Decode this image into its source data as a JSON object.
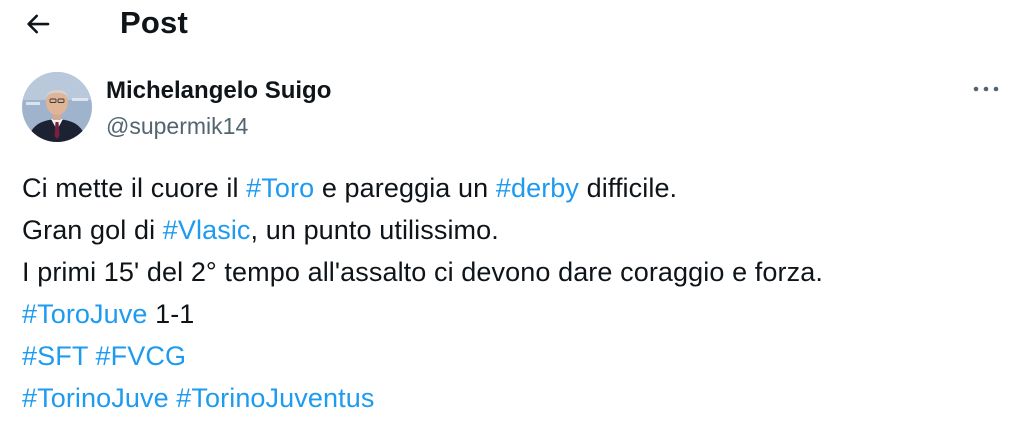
{
  "header": {
    "back_icon": "arrow-left-icon",
    "title": "Post"
  },
  "author": {
    "name": "Michelangelo Suigo",
    "handle": "@supermik14",
    "more_icon": "more-horizontal-icon"
  },
  "post": {
    "lines": [
      [
        {
          "t": "Ci mette il cuore il "
        },
        {
          "t": "#Toro",
          "tag": true
        },
        {
          "t": " e pareggia un "
        },
        {
          "t": "#derby",
          "tag": true
        },
        {
          "t": " difficile."
        }
      ],
      [
        {
          "t": "Gran gol di "
        },
        {
          "t": "#Vlasic",
          "tag": true
        },
        {
          "t": ", un punto utilissimo."
        }
      ],
      [
        {
          "t": "I primi 15' del 2° tempo all'assalto ci devono dare coraggio e forza."
        }
      ],
      [
        {
          "t": "#ToroJuve",
          "tag": true
        },
        {
          "t": " 1-1"
        }
      ],
      [
        {
          "t": "#SFT",
          "tag": true
        },
        {
          "t": " "
        },
        {
          "t": "#FVCG",
          "tag": true
        }
      ],
      [
        {
          "t": "#TorinoJuve",
          "tag": true
        },
        {
          "t": " "
        },
        {
          "t": "#TorinoJuventus",
          "tag": true
        }
      ]
    ]
  },
  "colors": {
    "text": "#0f1419",
    "secondary": "#536471",
    "hashtag": "#1d9bf0",
    "background": "#ffffff"
  }
}
